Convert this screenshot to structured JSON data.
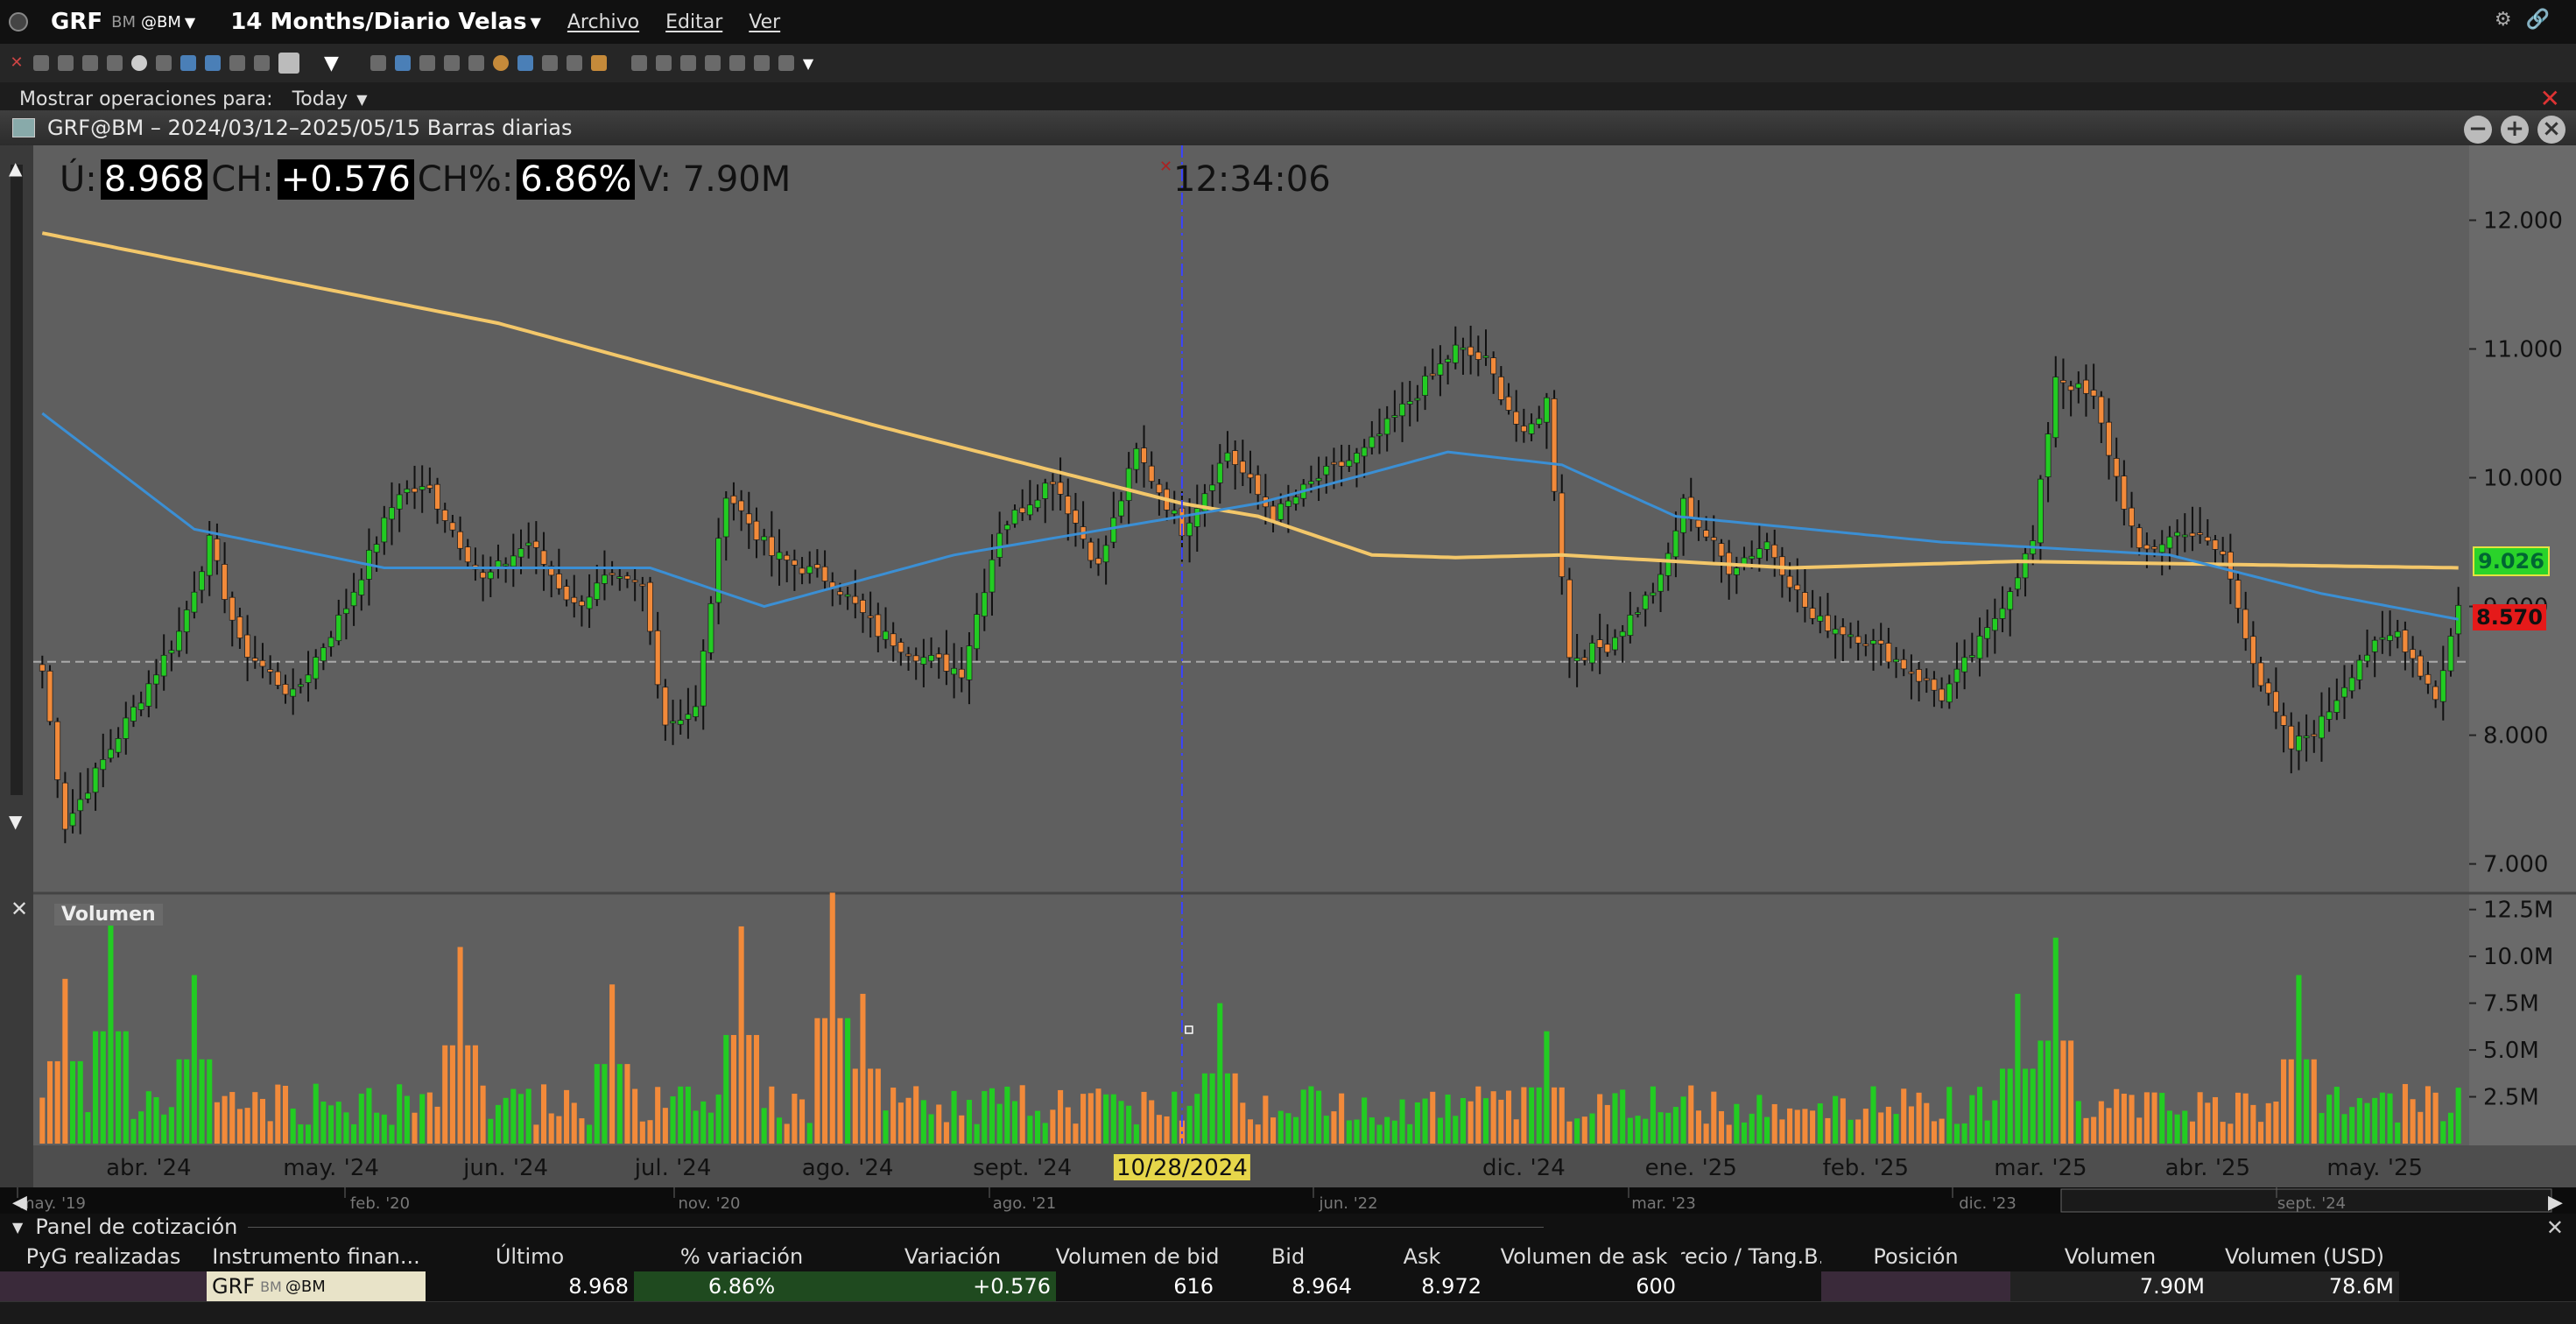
{
  "titlebar": {
    "symbol": "GRF",
    "exchange": "BM",
    "route": "@BM",
    "period": "14 Months/Diario Velas",
    "menus": [
      "Archivo",
      "Editar",
      "Ver"
    ]
  },
  "ops": {
    "label": "Mostrar operaciones para:",
    "value": "Today"
  },
  "chart_header": {
    "title": "GRF@BM – 2024/03/12–2025/05/15 Barras diarias"
  },
  "readout": {
    "last_label": "Ú:",
    "last": "8.968",
    "ch_label": "CH:",
    "ch": "+0.576",
    "chpct_label": "CH%:",
    "chpct": "6.86%",
    "vol": "V: 7.90M",
    "time": "12:34:06"
  },
  "price_tags": {
    "last": "9.026",
    "low": "8.570"
  },
  "volume_label": "Volumen",
  "cursor_date": "10/28/2024",
  "colors": {
    "up": "#22cc22",
    "down": "#f28a3a",
    "ma_fast": "#3b8fd4",
    "ma_slow": "#f3c76a",
    "cursor": "#3a44ff",
    "bg": "#5e5e5e"
  },
  "chart_data": {
    "type": "candlestick",
    "title": "GRF@BM – 2024/03/12–2025/05/15 Barras diarias",
    "price_axis": {
      "ylim": [
        6.8,
        12.5
      ],
      "ticks": [
        7,
        8,
        9,
        10,
        11,
        12
      ],
      "tick_labels": [
        "7.000",
        "8.000",
        "9.000",
        "10.000",
        "11.000",
        "12.000"
      ]
    },
    "volume_axis": {
      "ylim": [
        0,
        13000000
      ],
      "ticks": [
        2500000,
        5000000,
        7500000,
        10000000,
        12500000
      ],
      "tick_labels": [
        "2.5M",
        "5.0M",
        "7.5M",
        "10.0M",
        "12.5M"
      ]
    },
    "x_tick_labels": [
      "abr. '24",
      "may. '24",
      "jun. '24",
      "jul. '24",
      "ago. '24",
      "sept. '24",
      "oct. '24",
      "nov. '24",
      "dic. '24",
      "ene. '25",
      "feb. '25",
      "mar. '25",
      "abr. '25",
      "may. '25"
    ],
    "reference_line": 8.57,
    "close_anchors": [
      [
        0,
        8.5
      ],
      [
        3,
        7.3
      ],
      [
        8,
        7.8
      ],
      [
        18,
        8.8
      ],
      [
        22,
        9.5
      ],
      [
        26,
        8.7
      ],
      [
        33,
        8.3
      ],
      [
        40,
        9.0
      ],
      [
        47,
        9.9
      ],
      [
        51,
        9.9
      ],
      [
        58,
        9.2
      ],
      [
        64,
        9.5
      ],
      [
        70,
        9.0
      ],
      [
        74,
        9.2
      ],
      [
        79,
        9.15
      ],
      [
        82,
        8.1
      ],
      [
        86,
        8.2
      ],
      [
        90,
        9.9
      ],
      [
        96,
        9.4
      ],
      [
        104,
        9.2
      ],
      [
        110,
        8.8
      ],
      [
        116,
        8.6
      ],
      [
        121,
        8.5
      ],
      [
        126,
        9.6
      ],
      [
        133,
        10.0
      ],
      [
        139,
        9.3
      ],
      [
        144,
        10.2
      ],
      [
        150,
        9.6
      ],
      [
        156,
        10.2
      ],
      [
        162,
        9.7
      ],
      [
        168,
        10.0
      ],
      [
        174,
        10.2
      ],
      [
        180,
        10.6
      ],
      [
        186,
        11.0
      ],
      [
        190,
        10.9
      ],
      [
        195,
        10.3
      ],
      [
        198,
        10.6
      ],
      [
        201,
        8.6
      ],
      [
        206,
        8.7
      ],
      [
        213,
        9.2
      ],
      [
        216,
        9.8
      ],
      [
        222,
        9.3
      ],
      [
        227,
        9.5
      ],
      [
        233,
        8.9
      ],
      [
        240,
        8.75
      ],
      [
        246,
        8.5
      ],
      [
        250,
        8.3
      ],
      [
        256,
        8.8
      ],
      [
        262,
        9.5
      ],
      [
        265,
        10.8
      ],
      [
        270,
        10.6
      ],
      [
        276,
        9.4
      ],
      [
        282,
        9.6
      ],
      [
        287,
        9.4
      ],
      [
        292,
        8.4
      ],
      [
        296,
        7.9
      ],
      [
        300,
        8.1
      ],
      [
        305,
        8.6
      ],
      [
        310,
        8.8
      ],
      [
        315,
        8.3
      ],
      [
        318,
        9.0
      ]
    ],
    "ma_fast_anchors": [
      [
        0,
        10.5
      ],
      [
        20,
        9.6
      ],
      [
        45,
        9.3
      ],
      [
        80,
        9.3
      ],
      [
        95,
        9.0
      ],
      [
        120,
        9.4
      ],
      [
        160,
        9.8
      ],
      [
        185,
        10.2
      ],
      [
        200,
        10.1
      ],
      [
        215,
        9.7
      ],
      [
        250,
        9.5
      ],
      [
        280,
        9.4
      ],
      [
        300,
        9.1
      ],
      [
        318,
        8.9
      ]
    ],
    "ma_slow_anchors": [
      [
        0,
        11.9
      ],
      [
        60,
        11.2
      ],
      [
        110,
        10.4
      ],
      [
        150,
        9.8
      ],
      [
        160,
        9.7
      ],
      [
        175,
        9.4
      ],
      [
        186,
        9.38
      ],
      [
        200,
        9.4
      ],
      [
        230,
        9.3
      ],
      [
        260,
        9.35
      ],
      [
        318,
        9.3
      ]
    ],
    "n_bars": 319,
    "volume_spikes": [
      [
        3,
        8.8
      ],
      [
        9,
        12.0
      ],
      [
        20,
        9.0
      ],
      [
        55,
        10.5
      ],
      [
        75,
        8.5
      ],
      [
        92,
        11.6
      ],
      [
        104,
        13.4
      ],
      [
        108,
        8.0
      ],
      [
        155,
        7.5
      ],
      [
        198,
        6.0
      ],
      [
        260,
        8.0
      ],
      [
        265,
        11.0
      ],
      [
        297,
        9.0
      ]
    ]
  },
  "navigator": {
    "labels": [
      "may. '19",
      "feb. '20",
      "nov. '20",
      "ago. '21",
      "jun. '22",
      "mar. '23",
      "dic. '23",
      "sept. '24"
    ]
  },
  "quote_panel": {
    "title": "Panel de cotización",
    "headers": [
      "PyG realizadas",
      "Instrumento finan...",
      "Último",
      "% variación",
      "Variación",
      "Volumen de bid",
      "Bid",
      "Ask",
      "Volumen de ask",
      "Precio / Tang.B...",
      "Posición",
      "Volumen",
      "Volumen (USD)"
    ],
    "row": {
      "pnl": "",
      "instrument_symbol": "GRF",
      "instrument_exchange": "BM",
      "instrument_route": "@BM",
      "last": "8.968",
      "pct_change": "6.86%",
      "change": "+0.576",
      "bid_volume": "616",
      "bid": "8.964",
      "ask": "8.972",
      "ask_volume": "600",
      "price_tang": "",
      "position": "",
      "volume": "7.90M",
      "volume_usd": "78.6M"
    }
  }
}
